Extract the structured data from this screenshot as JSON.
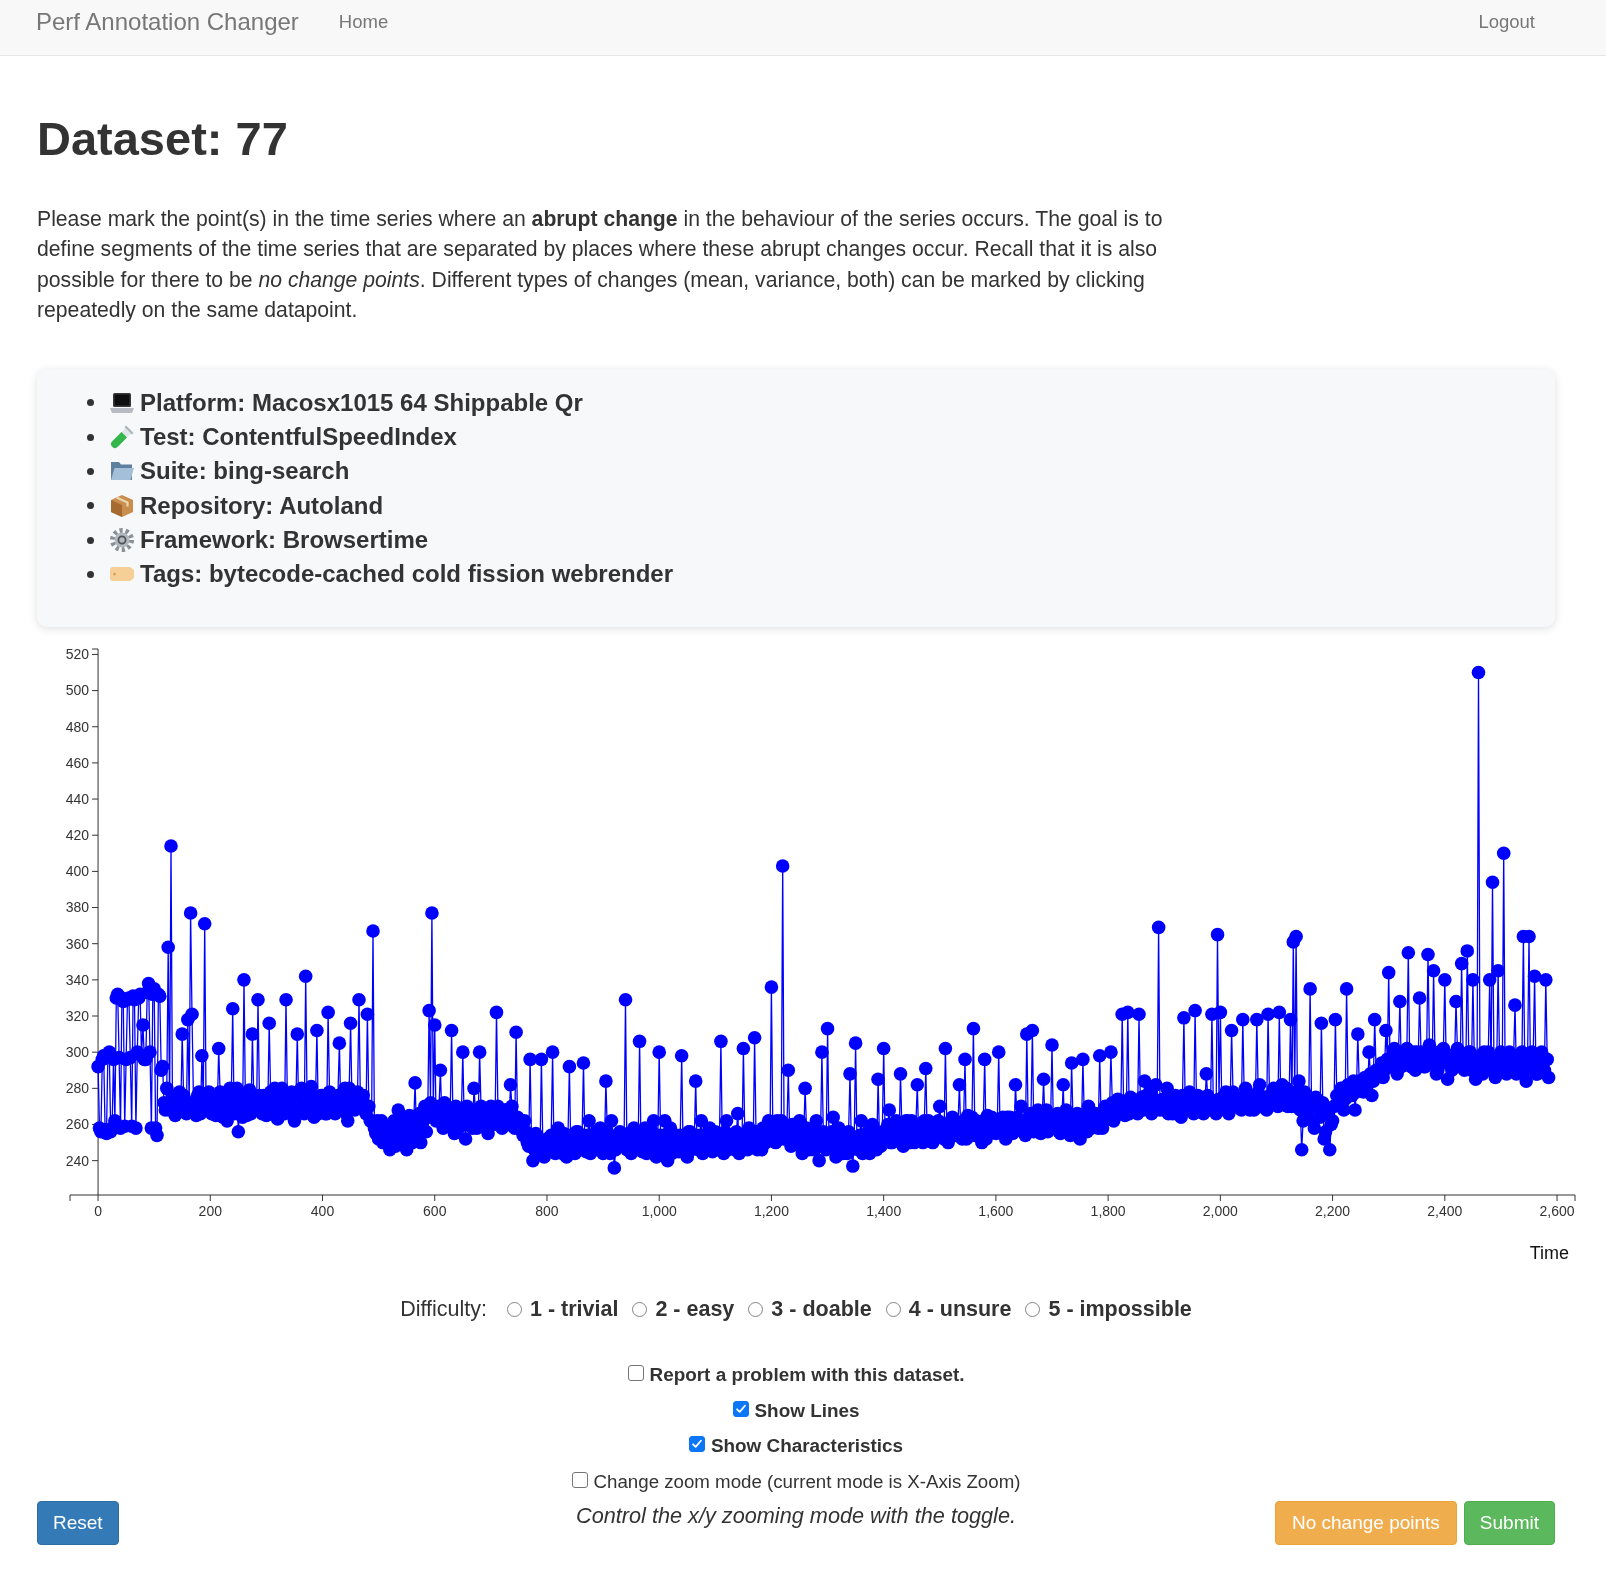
{
  "navbar": {
    "brand": "Perf Annotation Changer",
    "links": [
      {
        "label": "Home"
      }
    ],
    "logout": "Logout"
  },
  "title": "Dataset: 77",
  "instructions": "Please mark the point(s) in the time series where an **abrupt change** in the behaviour of the series occurs. The goal is to define segments of the time series that are separated by places where these abrupt changes occur. Recall that it is also possible for there to be *no change points*. Different types of changes (mean, variance, both) can be marked by clicking repeatedly on the same datapoint.",
  "characteristics": [
    {
      "kind": "platform",
      "text": "Platform: Macosx1015 64 Shippable Qr"
    },
    {
      "kind": "test",
      "text": "Test: ContentfulSpeedIndex"
    },
    {
      "kind": "suite",
      "text": "Suite: bing-search"
    },
    {
      "kind": "repository",
      "text": "Repository: Autoland"
    },
    {
      "kind": "framework",
      "text": "Framework: Browsertime"
    },
    {
      "kind": "tags",
      "text": "Tags: bytecode-cached cold fission webrender"
    }
  ],
  "chart": {
    "chart_data": {
      "type": "line",
      "xlabel": "Time",
      "xlim": [
        -50,
        2632
      ],
      "ylim": [
        221,
        523
      ],
      "xticks": [
        0,
        200,
        400,
        600,
        800,
        {
          "value": 1000,
          "label": "1,000"
        },
        {
          "value": 1200,
          "label": "1,200"
        },
        {
          "value": 1400,
          "label": "1,400"
        },
        {
          "value": 1600,
          "label": "1,600"
        },
        {
          "value": 1800,
          "label": "1,800"
        },
        {
          "value": 2000,
          "label": "2,000"
        },
        {
          "value": 2200,
          "label": "2,200"
        },
        {
          "value": 2400,
          "label": "2,400"
        },
        {
          "value": 2600,
          "label": "2,600"
        }
      ],
      "yticks": [
        240,
        260,
        280,
        300,
        320,
        340,
        360,
        380,
        400,
        420,
        440,
        460,
        480,
        500,
        520
      ],
      "x": [
        0,
        2.5,
        5,
        7.5,
        10,
        12.5,
        15,
        17.5,
        20,
        22.5,
        25,
        27.5,
        30,
        32.5,
        35,
        37.5,
        40,
        42.5,
        45,
        47.5,
        50,
        52.5,
        55,
        57.5,
        60,
        62.5,
        65,
        67.5,
        70,
        72.5,
        75,
        77.5,
        80,
        82.5,
        85,
        87.5,
        90,
        92.5,
        95,
        97.5,
        100,
        102.5,
        105,
        107.5,
        110,
        112.5,
        115,
        117.5,
        120,
        122.5,
        125,
        127.5,
        130,
        132.5,
        135,
        137.5,
        140,
        142.5,
        145,
        147.5,
        150,
        152.5,
        155,
        157.5,
        160,
        162.5,
        165,
        167.5,
        170,
        172.5,
        175,
        177.5,
        180,
        182.5,
        185,
        187.5,
        190,
        192.5,
        195,
        197.5,
        200,
        202.5,
        205,
        207.5,
        210,
        212.5,
        215,
        217.5,
        220,
        222.5,
        225,
        227.5,
        230,
        232.5,
        235,
        237.5,
        240,
        242.5,
        245,
        247.5,
        250,
        252.5,
        255,
        257.5,
        260,
        262.5,
        265,
        267.5,
        270,
        272.5,
        275,
        277.5,
        280,
        282.5,
        285,
        287.5,
        290,
        292.5,
        295,
        297.5,
        300,
        302.5,
        305,
        307.5,
        310,
        312.5,
        315,
        317.5,
        320,
        322.5,
        325,
        327.5,
        330,
        332.5,
        335,
        337.5,
        340,
        342.5,
        345,
        347.5,
        350,
        352.5,
        355,
        357.5,
        360,
        362.5,
        365,
        367.5,
        370,
        372.5,
        375,
        377.5,
        380,
        382.5,
        385,
        387.5,
        390,
        392.5,
        395,
        397.5,
        400,
        402.5,
        405,
        407.5,
        410,
        412.5,
        415,
        417.5,
        420,
        422.5,
        425,
        427.5,
        430,
        432.5,
        435,
        437.5,
        440,
        442.5,
        445,
        447.5,
        450,
        452.5,
        455,
        457.5,
        460,
        462.5,
        465,
        467.5,
        470,
        472.5,
        475,
        477.5,
        480,
        482.5,
        485,
        487.5,
        490,
        492.5,
        495,
        497.5,
        500,
        502.5,
        505,
        507.5,
        510,
        512.5,
        515,
        517.5,
        520,
        522.5,
        525,
        527.5,
        530,
        532.5,
        535,
        537.5,
        540,
        542.5,
        545,
        547.5,
        550,
        552.5,
        555,
        557.5,
        560,
        562.5,
        565,
        567.5,
        570,
        572.5,
        575,
        577.5,
        580,
        582.5,
        585,
        587.5,
        590,
        592.5,
        595,
        597.5,
        600,
        602.5,
        605,
        607.5,
        610,
        612.5,
        615,
        617.5,
        620,
        622.5,
        625,
        627.5,
        630,
        632.5,
        635,
        637.5,
        640,
        642.5,
        645,
        647.5,
        650,
        652.5,
        655,
        657.5,
        660,
        662.5,
        665,
        667.5,
        670,
        672.5,
        675,
        677.5,
        680,
        682.5,
        685,
        687.5,
        690,
        692.5,
        695,
        697.5,
        700,
        702.5,
        705,
        707.5,
        710,
        712.5,
        715,
        717.5,
        720,
        722.5,
        725,
        727.5,
        730,
        732.5,
        735,
        737.5,
        740,
        742.5,
        745,
        747.5,
        750,
        752.5,
        755,
        757.5,
        760,
        762.5,
        765,
        767.5,
        770,
        772.5,
        775,
        777.5,
        780,
        782.5,
        785,
        787.5,
        790,
        792.5,
        795,
        797.5,
        800,
        802.5,
        805,
        807.5,
        810,
        812.5,
        815,
        817.5,
        820,
        822.5,
        825,
        827.5,
        830,
        832.5,
        835,
        837.5,
        840,
        842.5,
        845,
        847.5,
        850,
        852.5,
        855,
        857.5,
        860,
        862.5,
        865,
        867.5,
        870,
        872.5,
        875,
        877.5,
        880,
        882.5,
        885,
        887.5,
        890,
        892.5,
        895,
        897.5,
        900,
        902.5,
        905,
        907.5,
        910,
        912.5,
        915,
        917.5,
        920,
        922.5,
        925,
        927.5,
        930,
        932.5,
        935,
        937.5,
        940,
        942.5,
        945,
        947.5,
        950,
        952.5,
        955,
        957.5,
        960,
        962.5,
        965,
        967.5,
        970,
        972.5,
        975,
        977.5,
        980,
        982.5,
        985,
        987.5,
        990,
        992.5,
        995,
        997.5,
        1000,
        1002.5,
        1005,
        1007.5,
        1010,
        1012.5,
        1015,
        1017.5,
        1020,
        1022.5,
        1025,
        1027.5,
        1030,
        1032.5,
        1035,
        1037.5,
        1040,
        1042.5,
        1045,
        1047.5,
        1050,
        1052.5,
        1055,
        1057.5,
        1060,
        1062.5,
        1065,
        1067.5,
        1070,
        1072.5,
        1075,
        1077.5,
        1080,
        1082.5,
        1085,
        1087.5,
        1090,
        1092.5,
        1095,
        1097.5,
        1100,
        1102.5,
        1105,
        1107.5,
        1110,
        1112.5,
        1115,
        1117.5,
        1120,
        1122.5,
        1125,
        1127.5,
        1130,
        1132.5,
        1135,
        1137.5,
        1140,
        1142.5,
        1145,
        1147.5,
        1150,
        1152.5,
        1155,
        1157.5,
        1160,
        1162.5,
        1165,
        1167.5,
        1170,
        1172.5,
        1175,
        1177.5,
        1180,
        1182.5,
        1185,
        1187.5,
        1190,
        1192.5,
        1195,
        1197.5,
        1200,
        1202.5,
        1205,
        1207.5,
        1210,
        1212.5,
        1215,
        1217.5,
        1220,
        1222.5,
        1225,
        1227.5,
        1230,
        1232.5,
        1235,
        1237.5,
        1240,
        1242.5,
        1245,
        1247.5,
        1250,
        1252.5,
        1255,
        1257.5,
        1260,
        1262.5,
        1265,
        1267.5,
        1270,
        1272.5,
        1275,
        1277.5,
        1280,
        1282.5,
        1285,
        1287.5,
        1290,
        1292.5,
        1295,
        1297.5,
        1300,
        1302.5,
        1305,
        1307.5,
        1310,
        1312.5,
        1315,
        1317.5,
        1320,
        1322.5,
        1325,
        1327.5,
        1330,
        1332.5,
        1335,
        1337.5,
        1340,
        1342.5,
        1345,
        1347.5,
        1350,
        1352.5,
        1355,
        1357.5,
        1360,
        1362.5,
        1365,
        1367.5,
        1370,
        1372.5,
        1375,
        1377.5,
        1380,
        1382.5,
        1385,
        1387.5,
        1390,
        1392.5,
        1395,
        1397.5,
        1400,
        1402.5,
        1405,
        1407.5,
        1410,
        1412.5,
        1415,
        1417.5,
        1420,
        1422.5,
        1425,
        1427.5,
        1430,
        1432.5,
        1435,
        1437.5,
        1440,
        1442.5,
        1445,
        1447.5,
        1450,
        1452.5,
        1455,
        1457.5,
        1460,
        1462.5,
        1465,
        1467.5,
        1470,
        1472.5,
        1475,
        1477.5,
        1480,
        1482.5,
        1485,
        1487.5,
        1490,
        1492.5,
        1495,
        1497.5,
        1500,
        1502.5,
        1505,
        1507.5,
        1510,
        1512.5,
        1515,
        1517.5,
        1520,
        1522.5,
        1525,
        1527.5,
        1530,
        1532.5,
        1535,
        1537.5,
        1540,
        1542.5,
        1545,
        1547.5,
        1550,
        1552.5,
        1555,
        1557.5,
        1560,
        1562.5,
        1565,
        1567.5,
        1570,
        1572.5,
        1575,
        1577.5,
        1580,
        1582.5,
        1585,
        1587.5,
        1590,
        1592.5,
        1595,
        1597.5,
        1600,
        1602.5,
        1605,
        1607.5,
        1610,
        1612.5,
        1615,
        1617.5,
        1620,
        1622.5,
        1625,
        1627.5,
        1630,
        1632.5,
        1635,
        1637.5,
        1640,
        1642.5,
        1645,
        1647.5,
        1650,
        1652.5,
        1655,
        1657.5,
        1660,
        1662.5,
        1665,
        1667.5,
        1670,
        1672.5,
        1675,
        1677.5,
        1680,
        1682.5,
        1685,
        1687.5,
        1690,
        1692.5,
        1695,
        1697.5,
        1700,
        1702.5,
        1705,
        1707.5,
        1710,
        1712.5,
        1715,
        1717.5,
        1720,
        1722.5,
        1725,
        1727.5,
        1730,
        1732.5,
        1735,
        1737.5,
        1740,
        1742.5,
        1745,
        1747.5,
        1750,
        1752.5,
        1755,
        1757.5,
        1760,
        1762.5,
        1765,
        1767.5,
        1770,
        1772.5,
        1775,
        1777.5,
        1780,
        1782.5,
        1785,
        1787.5,
        1790,
        1792.5,
        1795,
        1797.5,
        1800,
        1802.5,
        1805,
        1807.5,
        1810,
        1812.5,
        1815,
        1817.5,
        1820,
        1822.5,
        1825,
        1827.5,
        1830,
        1832.5,
        1835,
        1837.5,
        1840,
        1842.5,
        1845,
        1847.5,
        1850,
        1852.5,
        1855,
        1857.5,
        1860,
        1862.5,
        1865,
        1867.5,
        1870,
        1872.5,
        1875,
        1877.5,
        1880,
        1882.5,
        1885,
        1887.5,
        1890,
        1892.5,
        1895,
        1897.5,
        1900,
        1902.5,
        1905,
        1907.5,
        1910,
        1912.5,
        1915,
        1917.5,
        1920,
        1922.5,
        1925,
        1927.5,
        1930,
        1932.5,
        1935,
        1937.5,
        1940,
        1942.5,
        1945,
        1947.5,
        1950,
        1952.5,
        1955,
        1957.5,
        1960,
        1962.5,
        1965,
        1967.5,
        1970,
        1972.5,
        1975,
        1977.5,
        1980,
        1982.5,
        1985,
        1987.5,
        1990,
        1992.5,
        1995,
        1997.5,
        2000,
        2002.5,
        2005,
        2007.5,
        2010,
        2012.5,
        2015,
        2017.5,
        2020,
        2022.5,
        2025,
        2027.5,
        2030,
        2032.5,
        2035,
        2037.5,
        2040,
        2042.5,
        2045,
        2047.5,
        2050,
        2052.5,
        2055,
        2057.5,
        2060,
        2062.5,
        2065,
        2067.5,
        2070,
        2072.5,
        2075,
        2077.5,
        2080,
        2082.5,
        2085,
        2087.5,
        2090,
        2092.5,
        2095,
        2097.5,
        2100,
        2102.5,
        2105,
        2107.5,
        2110,
        2112.5,
        2115,
        2117.5,
        2120,
        2122.5,
        2125,
        2127.5,
        2130,
        2132.5,
        2135,
        2137.5,
        2140,
        2142.5,
        2145,
        2147.5,
        2150,
        2152.5,
        2155,
        2157.5,
        2160,
        2162.5,
        2165,
        2167.5,
        2170,
        2172.5,
        2175,
        2177.5,
        2180,
        2182.5,
        2185,
        2187.5,
        2190,
        2192.5,
        2195,
        2197.5,
        2200,
        2202.5,
        2205,
        2207.5,
        2210,
        2212.5,
        2215,
        2217.5,
        2220,
        2222.5,
        2225,
        2227.5,
        2230,
        2232.5,
        2235,
        2237.5,
        2240,
        2242.5,
        2245,
        2247.5,
        2250,
        2252.5,
        2255,
        2257.5,
        2260,
        2262.5,
        2265,
        2267.5,
        2270,
        2272.5,
        2275,
        2277.5,
        2280,
        2282.5,
        2285,
        2287.5,
        2290,
        2292.5,
        2295,
        2297.5,
        2300,
        2302.5,
        2305,
        2307.5,
        2310,
        2312.5,
        2315,
        2317.5,
        2320,
        2322.5,
        2325,
        2327.5,
        2330,
        2332.5,
        2335,
        2337.5,
        2340,
        2342.5,
        2345,
        2347.5,
        2350,
        2352.5,
        2355,
        2357.5,
        2360,
        2362.5,
        2365,
        2367.5,
        2370,
        2372.5,
        2375,
        2377.5,
        2380,
        2382.5,
        2385,
        2387.5,
        2390,
        2392.5,
        2395,
        2397.5,
        2400,
        2402.5,
        2405,
        2407.5,
        2410,
        2412.5,
        2415,
        2417.5,
        2420,
        2422.5,
        2425,
        2427.5,
        2430,
        2432.5,
        2435,
        2437.5,
        2440,
        2442.5,
        2445,
        2447.5,
        2450,
        2452.5,
        2455,
        2457.5,
        2460,
        2462.5,
        2465,
        2467.5,
        2470,
        2472.5,
        2475,
        2477.5,
        2480,
        2482.5,
        2485,
        2487.5,
        2490,
        2492.5,
        2495,
        2497.5,
        2500,
        2502.5,
        2505,
        2507.5,
        2510,
        2512.5,
        2515,
        2517.5,
        2520,
        2522.5,
        2525,
        2527.5,
        2530,
        2532.5,
        2535,
        2537.5,
        2540,
        2542.5,
        2545,
        2547.5,
        2550,
        2552.5,
        2555,
        2557.5,
        2560,
        2562.5,
        2565,
        2567.5,
        2570,
        2572.5,
        2575,
        2577.5,
        2580,
        2582.5,
        2585
      ],
      "series": [
        {
          "color": "#0000ff",
          "marker": "circle",
          "values": [
            292,
            258,
            256,
            296,
            298,
            257,
            255,
            299,
            300,
            256,
            258,
            296,
            262,
            330,
            332,
            297,
            258,
            330,
            328,
            259,
            296,
            329,
            330,
            297,
            259,
            331,
            329,
            258,
            300,
            330,
            332,
            298,
            315,
            296,
            296,
            333,
            338,
            300,
            258,
            332,
            335,
            258,
            254,
            332,
            331,
            290,
            292,
            272,
            268,
            280,
            358,
            268,
            414,
            276,
            272,
            265,
            268,
            272,
            278,
            268,
            310,
            276,
            270,
            266,
            318,
            272,
            377,
            321,
            272,
            268,
            265,
            276,
            278,
            266,
            298,
            274,
            371,
            268,
            270,
            278,
            270,
            266,
            275,
            274,
            265,
            268,
            302,
            278,
            268,
            264,
            276,
            272,
            262,
            268,
            280,
            276,
            324,
            266,
            270,
            280,
            256,
            268,
            274,
            264,
            340,
            272,
            265,
            278,
            279,
            266,
            310,
            274,
            268,
            268,
            329,
            276,
            272,
            266,
            276,
            272,
            265,
            270,
            316,
            278,
            274,
            266,
            280,
            274,
            263,
            268,
            270,
            280,
            275,
            266,
            329,
            272,
            268,
            276,
            278,
            266,
            262,
            274,
            310,
            268,
            278,
            280,
            270,
            266,
            342,
            272,
            270,
            278,
            281,
            268,
            264,
            274,
            312,
            266,
            271,
            276,
            276,
            272,
            266,
            266,
            322,
            278,
            276,
            270,
            270,
            266,
            268,
            276,
            305,
            268,
            272,
            274,
            280,
            266,
            262,
            280,
            316,
            272,
            275,
            268,
            276,
            278,
            329,
            272,
            270,
            276,
            269,
            266,
            321,
            270,
            262,
            262,
            367,
            258,
            255,
            262,
            252,
            256,
            262,
            250,
            250,
            258,
            258,
            252,
            246,
            256,
            258,
            262,
            248,
            254,
            268,
            258,
            252,
            264,
            260,
            252,
            246,
            258,
            265,
            254,
            250,
            262,
            283,
            256,
            258,
            266,
            250,
            260,
            262,
            270,
            256,
            264,
            323,
            272,
            377,
            268,
            315,
            262,
            266,
            270,
            290,
            264,
            258,
            272,
            262,
            260,
            262,
            266,
            312,
            262,
            255,
            270,
            268,
            258,
            262,
            266,
            300,
            262,
            252,
            270,
            260,
            264,
            262,
            258,
            280,
            268,
            258,
            262,
            300,
            270,
            265,
            260,
            262,
            266,
            255,
            262,
            270,
            266,
            260,
            262,
            322,
            270,
            262,
            264,
            258,
            260,
            268,
            268,
            260,
            262,
            282,
            270,
            265,
            258,
            311,
            264,
            258,
            260,
            262,
            254,
            262,
            256,
            250,
            248,
            296,
            252,
            240,
            246,
            255,
            252,
            248,
            244,
            296,
            250,
            242,
            246,
            252,
            248,
            250,
            254,
            300,
            246,
            244,
            252,
            258,
            256,
            248,
            244,
            255,
            250,
            242,
            254,
            292,
            246,
            252,
            250,
            244,
            256,
            256,
            246,
            250,
            252,
            294,
            248,
            245,
            254,
            262,
            244,
            248,
            250,
            252,
            256,
            250,
            246,
            258,
            252,
            244,
            250,
            284,
            256,
            248,
            244,
            262,
            250,
            236,
            246,
            252,
            254,
            256,
            248,
            248,
            252,
            329,
            246,
            255,
            250,
            244,
            256,
            258,
            246,
            250,
            252,
            306,
            248,
            245,
            254,
            258,
            244,
            252,
            250,
            248,
            256,
            262,
            246,
            242,
            252,
            300,
            254,
            248,
            246,
            262,
            250,
            240,
            256,
            258,
            244,
            250,
            252,
            254,
            248,
            245,
            254,
            298,
            246,
            252,
            250,
            242,
            256,
            256,
            246,
            250,
            252,
            284,
            248,
            246,
            254,
            262,
            244,
            252,
            250,
            248,
            256,
            258,
            248,
            245,
            252,
            256,
            246,
            250,
            254,
            306,
            250,
            244,
            256,
            262,
            246,
            250,
            252,
            254,
            248,
            246,
            256,
            266,
            244,
            252,
            250,
            302,
            254,
            248,
            246,
            258,
            252,
            255,
            248,
            308,
            256,
            246,
            250,
            255,
            246,
            258,
            254,
            250,
            258,
            262,
            252,
            336,
            258,
            255,
            250,
            262,
            256,
            252,
            262,
            403,
            252,
            260,
            258,
            290,
            254,
            248,
            260,
            256,
            250,
            255,
            256,
            262,
            248,
            244,
            254,
            280,
            258,
            250,
            246,
            256,
            252,
            246,
            256,
            262,
            248,
            240,
            252,
            300,
            256,
            248,
            246,
            313,
            252,
            250,
            256,
            264,
            246,
            242,
            250,
            258,
            254,
            246,
            244,
            254,
            250,
            244,
            256,
            288,
            246,
            237,
            252,
            305,
            248,
            246,
            254,
            262,
            244,
            250,
            250,
            255,
            256,
            244,
            248,
            260,
            254,
            250,
            246,
            285,
            252,
            248,
            256,
            302,
            254,
            252,
            260,
            268,
            250,
            250,
            256,
            258,
            262,
            255,
            252,
            288,
            258,
            248,
            254,
            262,
            262,
            256,
            250,
            262,
            256,
            250,
            260,
            282,
            252,
            258,
            258,
            250,
            262,
            291,
            254,
            262,
            258,
            254,
            250,
            260,
            256,
            258,
            262,
            270,
            258,
            255,
            252,
            302,
            260,
            250,
            256,
            262,
            264,
            262,
            254,
            258,
            260,
            282,
            256,
            252,
            262,
            296,
            252,
            265,
            258,
            256,
            264,
            313,
            254,
            262,
            260,
            260,
            256,
            250,
            262,
            296,
            252,
            265,
            258,
            258,
            264,
            262,
            256,
            255,
            260,
            300,
            256,
            262,
            264,
            258,
            252,
            264,
            258,
            264,
            262,
            255,
            256,
            282,
            264,
            262,
            258,
            270,
            262,
            256,
            254,
            310,
            260,
            265,
            266,
            312,
            256,
            262,
            262,
            268,
            258,
            255,
            264,
            285,
            260,
            268,
            256,
            258,
            262,
            304,
            258,
            262,
            264,
            266,
            256,
            255,
            262,
            282,
            258,
            268,
            264,
            258,
            254,
            294,
            260,
            262,
            256,
            266,
            262,
            252,
            258,
            296,
            264,
            265,
            256,
            270,
            262,
            258,
            260,
            262,
            266,
            262,
            258,
            298,
            264,
            258,
            262,
            270,
            268,
            268,
            266,
            300,
            272,
            262,
            268,
            272,
            274,
            270,
            266,
            321,
            272,
            265,
            270,
            322,
            266,
            275,
            274,
            268,
            270,
            268,
            266,
            321,
            272,
            275,
            268,
            284,
            276,
            270,
            270,
            278,
            266,
            268,
            274,
            282,
            270,
            369,
            268,
            272,
            274,
            268,
            270,
            280,
            266,
            272,
            274,
            266,
            270,
            276,
            266,
            270,
            272,
            264,
            276,
            319,
            268,
            272,
            274,
            278,
            270,
            268,
            266,
            323,
            272,
            276,
            268,
            272,
            274,
            266,
            270,
            288,
            276,
            272,
            268,
            321,
            272,
            270,
            266,
            365,
            274,
            322,
            270,
            272,
            276,
            278,
            268,
            266,
            272,
            312,
            278,
            276,
            270,
            270,
            274,
            270,
            268,
            318,
            276,
            280,
            272,
            272,
            268,
            276,
            276,
            268,
            272,
            318,
            278,
            282,
            270,
            274,
            274,
            270,
            268,
            321,
            276,
            276,
            272,
            280,
            278,
            274,
            270,
            322,
            276,
            282,
            272,
            278,
            280,
            270,
            274,
            318,
            270,
            361,
            278,
            364,
            272,
            284,
            268,
            246,
            262,
            278,
            276,
            272,
            268,
            335,
            274,
            262,
            258,
            275,
            270,
            270,
            264,
            316,
            272,
            252,
            256,
            268,
            266,
            246,
            260,
            262,
            270,
            318,
            276,
            275,
            272,
            280,
            280,
            268,
            274,
            335,
            282,
            282,
            276,
            276,
            284,
            268,
            278,
            310,
            284,
            282,
            280,
            278,
            286,
            285,
            282,
            300,
            288,
            276,
            284,
            318,
            290,
            290,
            288,
            288,
            294,
            286,
            290,
            312,
            296,
            344,
            292,
            296,
            298,
            302,
            294,
            288,
            300,
            328,
            292,
            298,
            296,
            294,
            302,
            355,
            294,
            292,
            298,
            300,
            290,
            300,
            296,
            330,
            300,
            296,
            292,
            292,
            298,
            354,
            304,
            295,
            294,
            345,
            298,
            288,
            290,
            300,
            296,
            300,
            302,
            340,
            294,
            285,
            298,
            298,
            290,
            294,
            296,
            328,
            302,
            298,
            292,
            349,
            298,
            290,
            294,
            356,
            300,
            300,
            290,
            340,
            296,
            285,
            292,
            510,
            298,
            290,
            288,
            300,
            294,
            295,
            300,
            340,
            290,
            394,
            296,
            286,
            292,
            345,
            298,
            300,
            294,
            410,
            290,
            288,
            296,
            300,
            292,
            296,
            298,
            326,
            288,
            290,
            294,
            298,
            300,
            364,
            290,
            284,
            296,
            364,
            292,
            300,
            298,
            342,
            288,
            288,
            294,
            296,
            300,
            296,
            290,
            340,
            296,
            286
          ]
        }
      ]
    }
  },
  "difficulty": {
    "label": "Difficulty:",
    "options": [
      {
        "label": "1 - trivial",
        "selected": false
      },
      {
        "label": "2 - easy",
        "selected": false
      },
      {
        "label": "3 - doable",
        "selected": false
      },
      {
        "label": "4 - unsure",
        "selected": false
      },
      {
        "label": "5 - impossible",
        "selected": false
      }
    ]
  },
  "options": [
    {
      "kind": "bold",
      "label": "Report a problem with this dataset.",
      "checked": false
    },
    {
      "kind": "bold",
      "label": "Show Lines",
      "checked": true
    },
    {
      "kind": "bold",
      "label": "Show Characteristics",
      "checked": true
    },
    {
      "kind": "plain",
      "label": "Change zoom mode (current mode is X-Axis Zoom)",
      "checked": false
    }
  ],
  "hint": "Control the x/y zooming mode with the toggle.",
  "buttons": [
    {
      "kind": "primary",
      "label": "Reset"
    },
    {
      "kind": "warning",
      "label": "No change points"
    },
    {
      "kind": "success",
      "label": "Submit"
    }
  ]
}
